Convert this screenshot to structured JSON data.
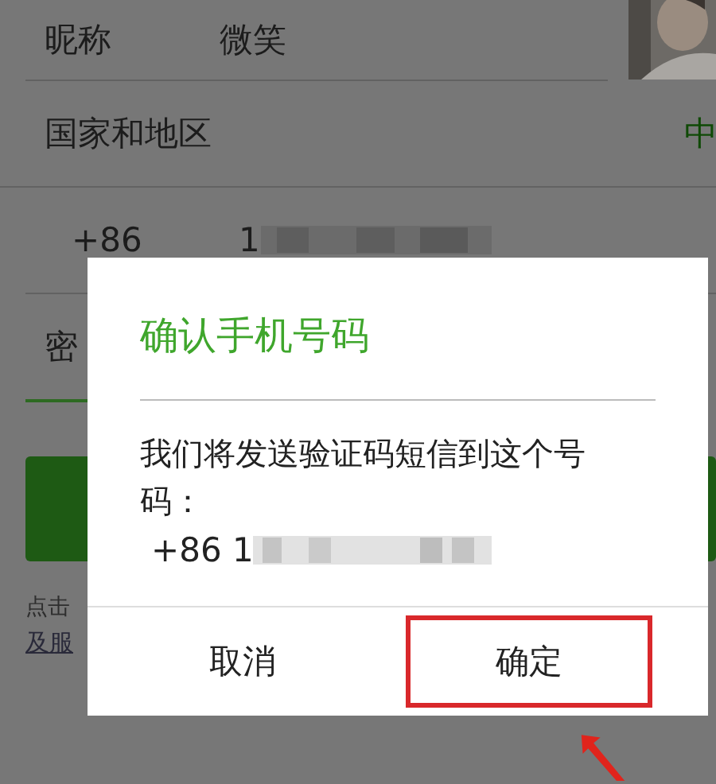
{
  "form": {
    "rows": [
      {
        "kind": "text",
        "label": "昵称",
        "value": "微笑"
      },
      {
        "kind": "select",
        "label": "国家和地区",
        "value": "中"
      },
      {
        "kind": "phone",
        "label": "+86",
        "value": "1"
      },
      {
        "kind": "password",
        "label": "密"
      }
    ],
    "agreement": {
      "text": "点击",
      "link": "及服"
    }
  },
  "dialog": {
    "title": "确认手机号码",
    "message": "我们将发送验证码短信到这个号码：",
    "phone": "+86 1",
    "buttons": [
      {
        "label": "取消",
        "highlighted": false
      },
      {
        "label": "确定",
        "highlighted": true
      }
    ]
  }
}
